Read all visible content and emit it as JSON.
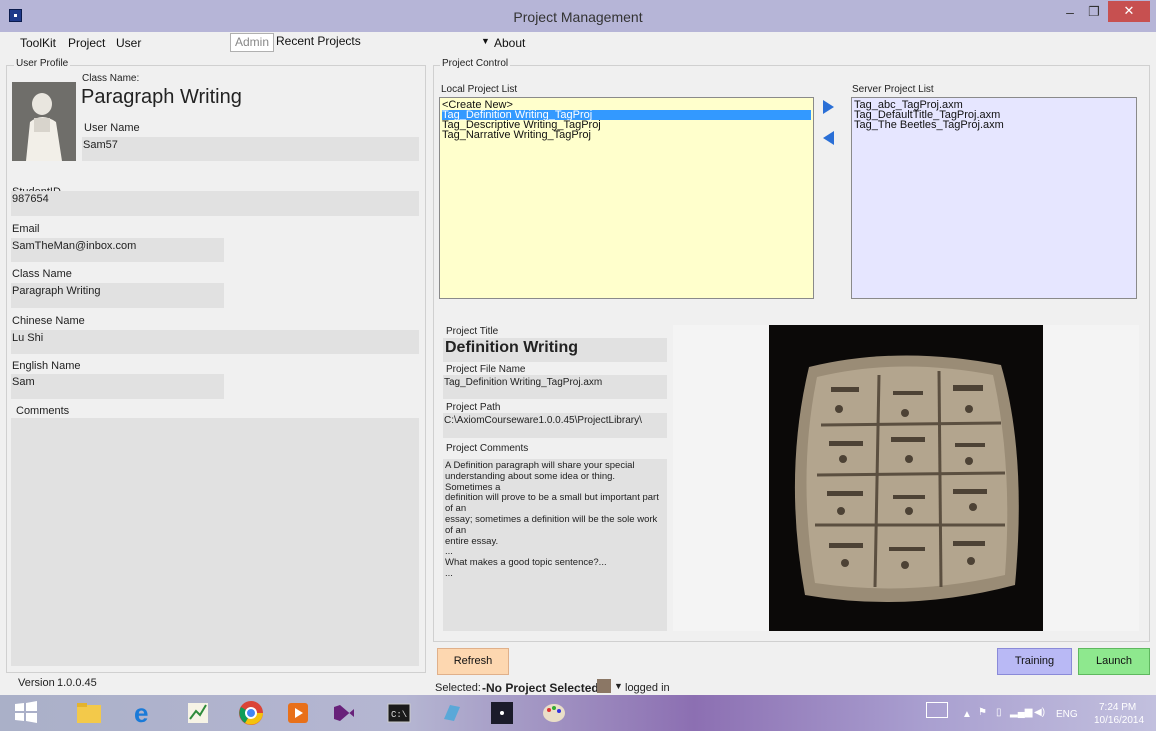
{
  "window": {
    "title": "Project Management",
    "minimize": "–",
    "maximize": "❐",
    "close": "✕"
  },
  "menu": {
    "toolkit": "ToolKit",
    "project": "Project",
    "user": "User",
    "admin": "Admin",
    "recent_projects": "Recent Projects",
    "about": "About"
  },
  "user_profile": {
    "legend": "User Profile",
    "class_name_label_top": "Class Name:",
    "class_name_big": "Paragraph Writing",
    "user_name_label": "User Name",
    "user_name": "Sam57",
    "student_id_label": "StudentID",
    "student_id": "987654",
    "email_label": "Email",
    "email": "SamTheMan@inbox.com",
    "class_name_label": "Class Name",
    "class_name": "Paragraph Writing",
    "chinese_name_label": "Chinese Name",
    "chinese_name": "Lu Shi",
    "english_name_label": "English Name",
    "english_name": "Sam",
    "comments_label": "Comments",
    "comments": ""
  },
  "project_control": {
    "legend": "Project Control",
    "local_label": "Local Project List",
    "local_items": [
      "<Create New>",
      "Tag_Definition Writing_TagProj",
      "Tag_Descriptive Writing_TagProj",
      "Tag_Narrative Writing_TagProj"
    ],
    "server_label": "Server Project List",
    "server_items": [
      "Tag_abc_TagProj.axm",
      "Tag_DefaultTitle_TagProj.axm",
      "Tag_The Beetles_TagProj.axm"
    ],
    "title_label": "Project Title",
    "title": "Definition Writing",
    "file_label": "Project File Name",
    "file": "Tag_Definition Writing_TagProj.axm",
    "path_label": "Project Path",
    "path": "C:\\AxiomCourseware1.0.0.45\\ProjectLibrary\\",
    "comments_label": "Project Comments",
    "comments_lines": [
      "A Definition paragraph will share your special",
      "understanding about some idea or thing. Sometimes a",
      "definition will prove to be a small but important part of an",
      "essay; sometimes a definition will be the sole work of an",
      "entire essay.",
      "...",
      "What makes a good topic sentence?...",
      "..."
    ]
  },
  "buttons": {
    "refresh": "Refresh",
    "training": "Training",
    "launch": "Launch"
  },
  "status": {
    "version_label": "Version",
    "version": "1.0.0.45",
    "selected_label": "Selected:",
    "selected_value": "-No Project Selected-",
    "logged_in": "logged in"
  },
  "taskbar": {
    "lang": "ENG",
    "time": "7:24 PM",
    "date": "10/16/2014"
  },
  "colors": {
    "title_bar": "#b6b5d7",
    "close": "#c75050",
    "local_list_bg": "#ffffcc",
    "server_list_bg": "#e6e6ff",
    "selected": "#3399ff",
    "refresh_bg": "#fdd7b0",
    "training_bg": "#b9b9f5",
    "launch_bg": "#8ee88e"
  }
}
